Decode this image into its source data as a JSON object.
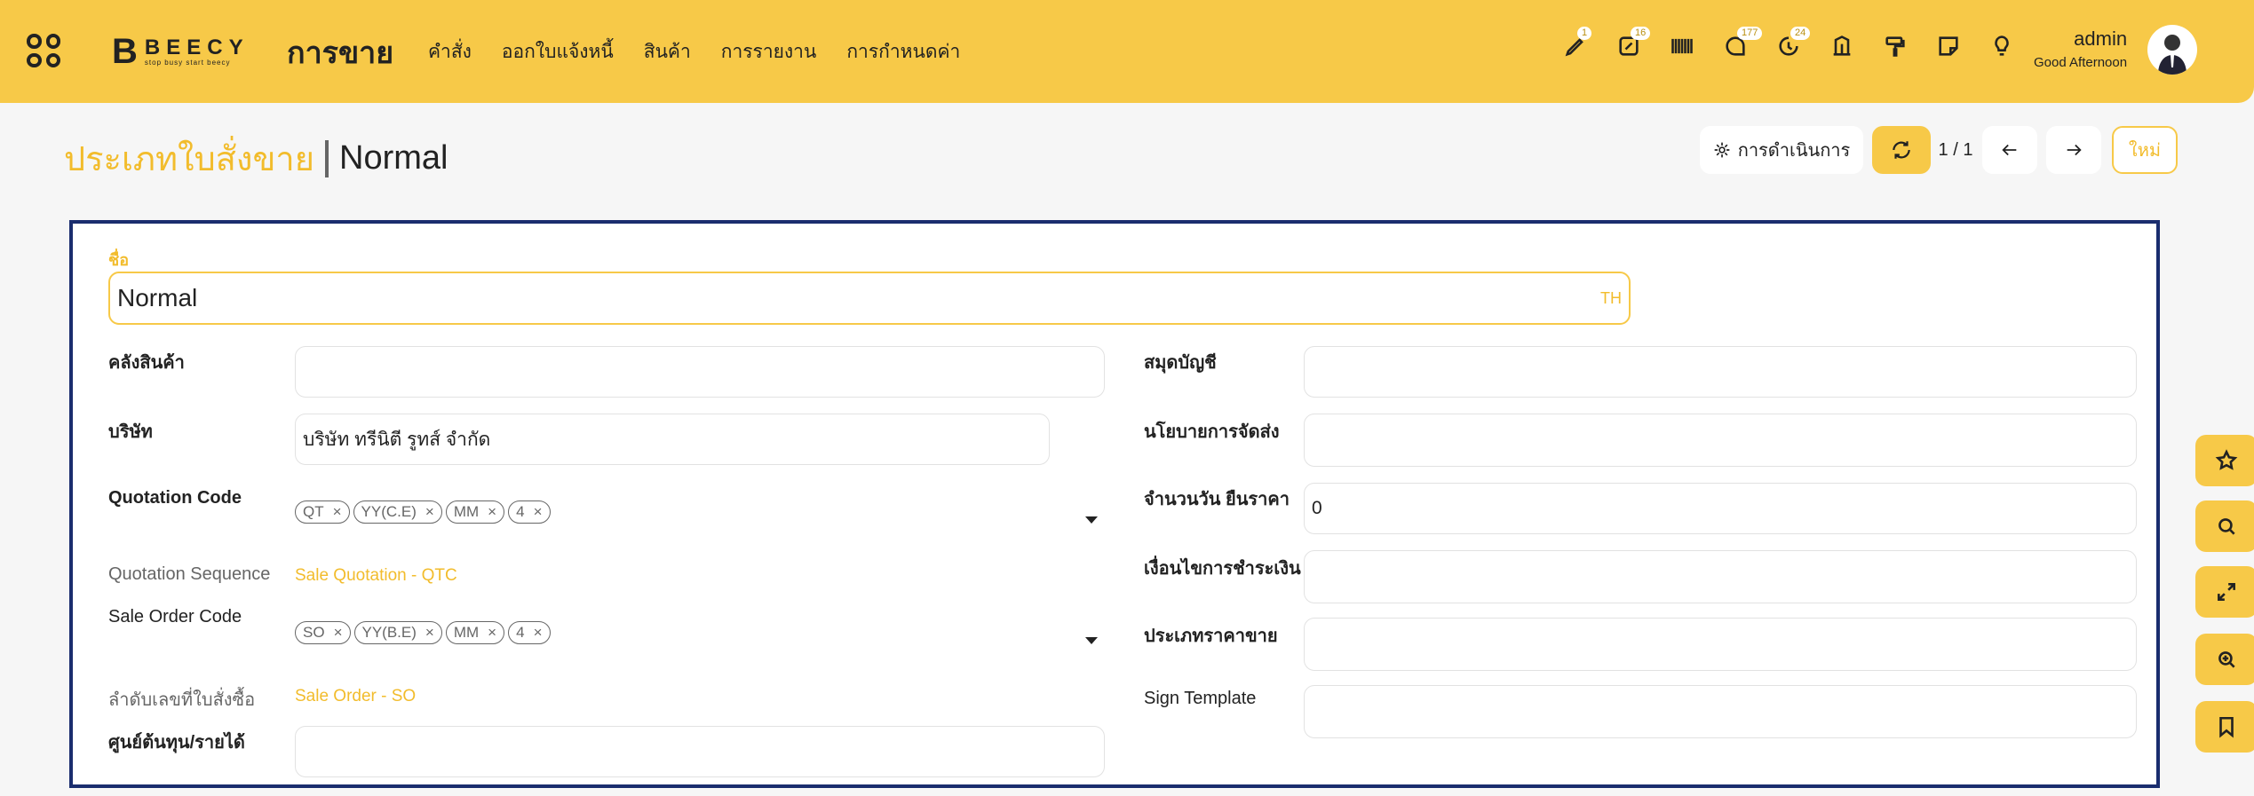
{
  "header": {
    "module": "การขาย",
    "menu": [
      "คำสั่ง",
      "ออกใบแจ้งหนี้",
      "สินค้า",
      "การรายงาน",
      "การกำหนดค่า"
    ],
    "logo_name": "BEECY",
    "logo_slogan": "stop busy start beecy",
    "icons": [
      {
        "name": "pencil-icon",
        "badge": "1"
      },
      {
        "name": "edit-note-icon",
        "badge": "16"
      },
      {
        "name": "barcode-icon",
        "badge": ""
      },
      {
        "name": "chat-icon",
        "badge": "177"
      },
      {
        "name": "activity-icon",
        "badge": "24"
      },
      {
        "name": "bank-icon",
        "badge": ""
      },
      {
        "name": "paint-roller-icon",
        "badge": ""
      },
      {
        "name": "sticky-note-icon",
        "badge": ""
      },
      {
        "name": "lightbulb-icon",
        "badge": ""
      }
    ],
    "user_name": "admin",
    "greeting": "Good Afternoon"
  },
  "breadcrumb": {
    "parent": "ประเภทใบสั่งขาย",
    "current": "Normal"
  },
  "actions": {
    "actions_label": "การดำเนินการ",
    "pager": "1 / 1",
    "new_label": "ใหม่"
  },
  "form": {
    "name_label": "ชื่อ",
    "name_value": "Normal",
    "lang": "TH",
    "warehouse_label": "คลังสินค้า",
    "warehouse_value": "",
    "company_label": "บริษัท",
    "company_value": "บริษัท ทรีนิตี รูทส์ จำกัด",
    "quotation_code_label": "Quotation Code",
    "quotation_code_tags": [
      "QT",
      "YY(C.E)",
      "MM",
      "4"
    ],
    "quotation_seq_label": "Quotation Sequence",
    "quotation_seq_value": "Sale Quotation - QTC",
    "sale_order_code_label": "Sale Order Code",
    "sale_order_code_tags": [
      "SO",
      "YY(B.E)",
      "MM",
      "4"
    ],
    "so_seq_label": "ลำดับเลขที่ใบสั่งซื้อ",
    "so_seq_value": "Sale Order - SO",
    "cost_center_label": "ศูนย์ต้นทุน/รายได้",
    "cost_center_value": "",
    "journal_label": "สมุดบัญชี",
    "journal_value": "",
    "delivery_policy_label": "นโยบายการจัดส่ง",
    "delivery_policy_value": "",
    "validity_label": "จำนวนวัน ยืนราคา",
    "validity_value": "0",
    "payment_terms_label": "เงื่อนไขการชำระเงิน",
    "payment_terms_value": "",
    "pricelist_label": "ประเภทราคาขาย",
    "pricelist_value": "",
    "sign_template_label": "Sign Template",
    "sign_template_value": ""
  },
  "colors": {
    "brand": "#f7c948",
    "accent": "#f2bc2c",
    "frame": "#1a2d6e"
  }
}
